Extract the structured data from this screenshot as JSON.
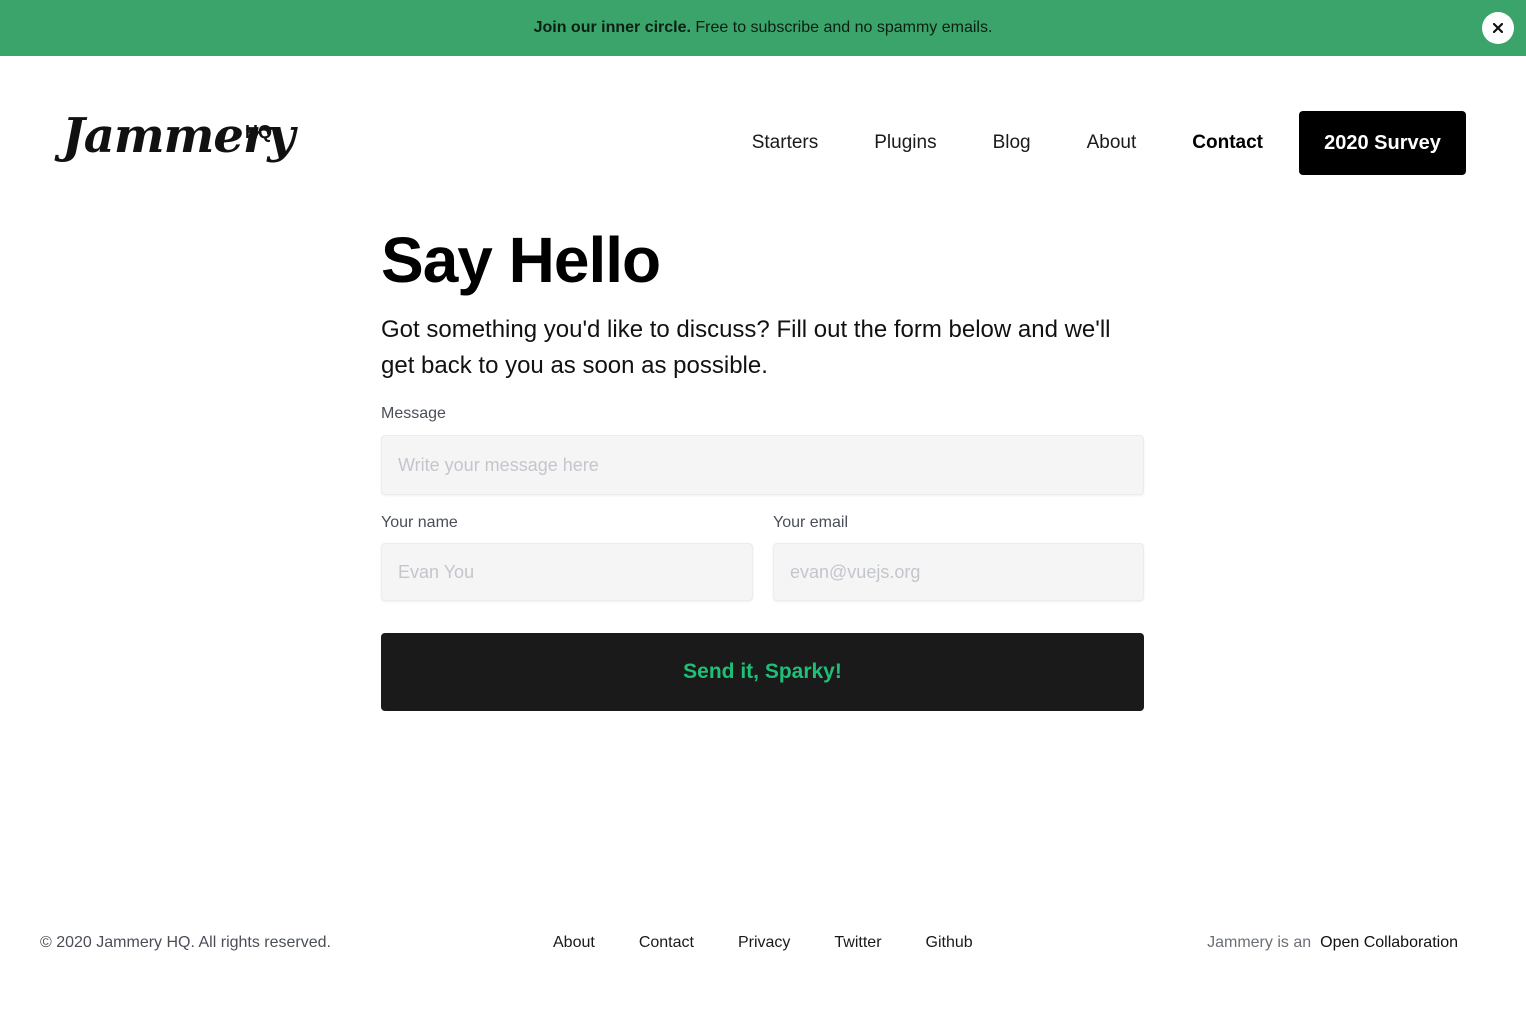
{
  "banner": {
    "bold_text": "Join our inner circle.",
    "text": " Free to subscribe and no spammy emails.",
    "close_icon": "close-icon"
  },
  "header": {
    "logo_script": "Jammery",
    "logo_badge": "HQ",
    "nav": [
      {
        "label": "Starters"
      },
      {
        "label": "Plugins"
      },
      {
        "label": "Blog"
      },
      {
        "label": "About"
      },
      {
        "label": "Contact",
        "active": true
      }
    ],
    "cta_label": "2020 Survey"
  },
  "main": {
    "title": "Say Hello",
    "intro": "Got something you'd like to discuss? Fill out the form below and we'll get back to you as soon as possible.",
    "message": {
      "label": "Message",
      "placeholder": "Write your message here",
      "value": ""
    },
    "name": {
      "label": "Your name",
      "placeholder": "Evan You",
      "value": ""
    },
    "email": {
      "label": "Your email",
      "placeholder": "evan@vuejs.org",
      "value": ""
    },
    "submit_label": "Send it, Sparky!"
  },
  "footer": {
    "copyright": "© 2020 Jammery HQ. All rights reserved.",
    "links": [
      {
        "label": "About"
      },
      {
        "label": "Contact"
      },
      {
        "label": "Privacy"
      },
      {
        "label": "Twitter"
      },
      {
        "label": "Github"
      }
    ],
    "collab_prefix": "Jammery is an",
    "collab_link": "Open Collaboration"
  },
  "colors": {
    "banner_bg": "#3aa46a",
    "button_bg": "#1a1a1a",
    "submit_text": "#1fbf77",
    "cta_bg": "#000000"
  }
}
